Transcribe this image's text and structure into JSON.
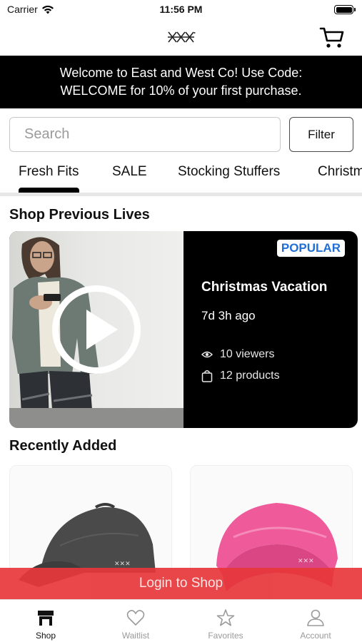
{
  "status_bar": {
    "carrier": "Carrier",
    "time": "11:56 PM"
  },
  "header": {
    "logo_icon": "brand-logo-icon",
    "cart_icon": "cart-icon"
  },
  "promo": {
    "line1": "Welcome to East and West Co! Use Code:",
    "line2": "WELCOME for 10% of your first purchase."
  },
  "search": {
    "placeholder": "Search",
    "value": ""
  },
  "filter_label": "Filter",
  "categories": [
    {
      "label": "Fresh Fits",
      "active": true
    },
    {
      "label": "SALE",
      "active": false
    },
    {
      "label": "Stocking Stuffers",
      "active": false
    },
    {
      "label": "Christm",
      "active": false
    }
  ],
  "previous_lives": {
    "title": "Shop Previous Lives",
    "card": {
      "badge": "POPULAR",
      "title": "Christmas Vacation",
      "time_ago": "7d 3h ago",
      "viewers": "10 viewers",
      "products": "12 products"
    }
  },
  "recently_added": {
    "title": "Recently Added"
  },
  "login_bar": {
    "label": "Login to Shop"
  },
  "tab_bar": [
    {
      "label": "Shop",
      "icon": "shop-icon",
      "active": true
    },
    {
      "label": "Waitlist",
      "icon": "heart-icon",
      "active": false
    },
    {
      "label": "Favorites",
      "icon": "star-icon",
      "active": false
    },
    {
      "label": "Account",
      "icon": "account-icon",
      "active": false
    }
  ],
  "colors": {
    "banner": "#000000",
    "login_bar": "#e8373b",
    "badge_text": "#1f6fd6",
    "beanie": "#ef5a9a",
    "cap": "#4a4a4a"
  }
}
